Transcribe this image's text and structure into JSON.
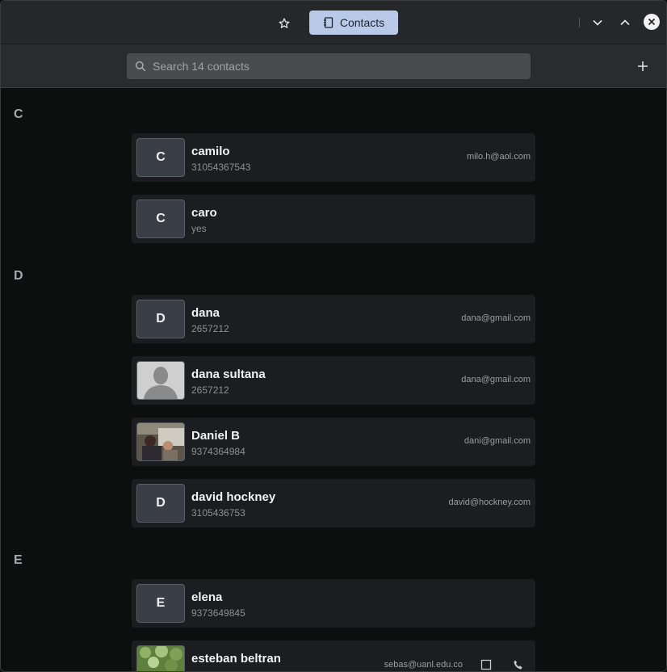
{
  "titlebar": {
    "tab_label": "Contacts"
  },
  "search": {
    "placeholder": "Search 14 contacts"
  },
  "sections": [
    {
      "letter": "C",
      "contacts": [
        {
          "avatar": "C",
          "name": "camilo",
          "sub": "31054367543",
          "email": "milo.h@aol.com"
        },
        {
          "avatar": "C",
          "name": "caro",
          "sub": "yes",
          "email": ""
        }
      ]
    },
    {
      "letter": "D",
      "contacts": [
        {
          "avatar": "D",
          "name": "dana",
          "sub": "2657212",
          "email": "dana@gmail.com"
        },
        {
          "avatar": "",
          "name": "dana sultana",
          "sub": "2657212",
          "email": "dana@gmail.com"
        },
        {
          "avatar": "",
          "name": "Daniel B",
          "sub": "9374364984",
          "email": "dani@gmail.com"
        },
        {
          "avatar": "D",
          "name": "david hockney",
          "sub": "3105436753",
          "email": "david@hockney.com"
        }
      ]
    },
    {
      "letter": "E",
      "contacts": [
        {
          "avatar": "E",
          "name": "elena",
          "sub": "9373649845",
          "email": ""
        },
        {
          "avatar": "",
          "name": "esteban beltran",
          "sub": "",
          "email": "sebas@uanl.edu.co"
        }
      ]
    }
  ],
  "colors": {
    "accent_tab": "#b9cae8",
    "card_bg": "#1c1d20",
    "window_bg": "#0d0e0e"
  },
  "icons": [
    "star-icon",
    "contacts-book-icon",
    "chevron-down-icon",
    "chevron-up-icon",
    "close-icon",
    "search-icon",
    "plus-icon",
    "message-icon",
    "phone-icon"
  ]
}
